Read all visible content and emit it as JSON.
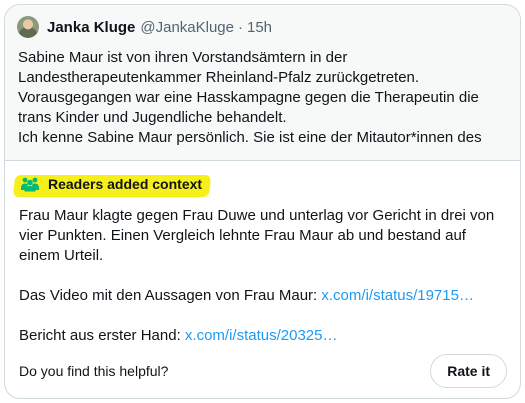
{
  "quoted_post": {
    "author_name": "Janka Kluge",
    "author_handle": "@JankaKluge",
    "separator": "·",
    "time": "15h",
    "text": "Sabine Maur ist von ihren Vorstandsämtern in der\nLandestherapeutenkammer Rheinland-Pfalz zurückgetreten.\nVorausgegangen war eine Hasskampagne gegen die Therapeutin die\ntrans Kinder und Jugendliche behandelt.\nIch kenne Sabine Maur persönlich. Sie ist eine der Mitautor*innen des"
  },
  "community_note": {
    "title": "Readers added context",
    "paragraph_1": "Frau Maur klagte gegen Frau Duwe und unterlag vor Gericht in drei von vier Punkten. Einen Vergleich lehnte Frau Maur ab und bestand auf einem Urteil.",
    "paragraph_2_prefix": "Das Video mit den Aussagen von Frau Maur: ",
    "paragraph_2_link": "x.com/i/status/19715…",
    "paragraph_3_prefix": "Bericht aus erster Hand: ",
    "paragraph_3_link": "x.com/i/status/20325…",
    "helpful_prompt": "Do you find this helpful?",
    "rate_button": "Rate it"
  },
  "colors": {
    "link": "#1d9bf0",
    "note_icon": "#00ba7c",
    "highlight": "#f6ef1a"
  },
  "icons": {
    "note_icon": "people-icon"
  }
}
